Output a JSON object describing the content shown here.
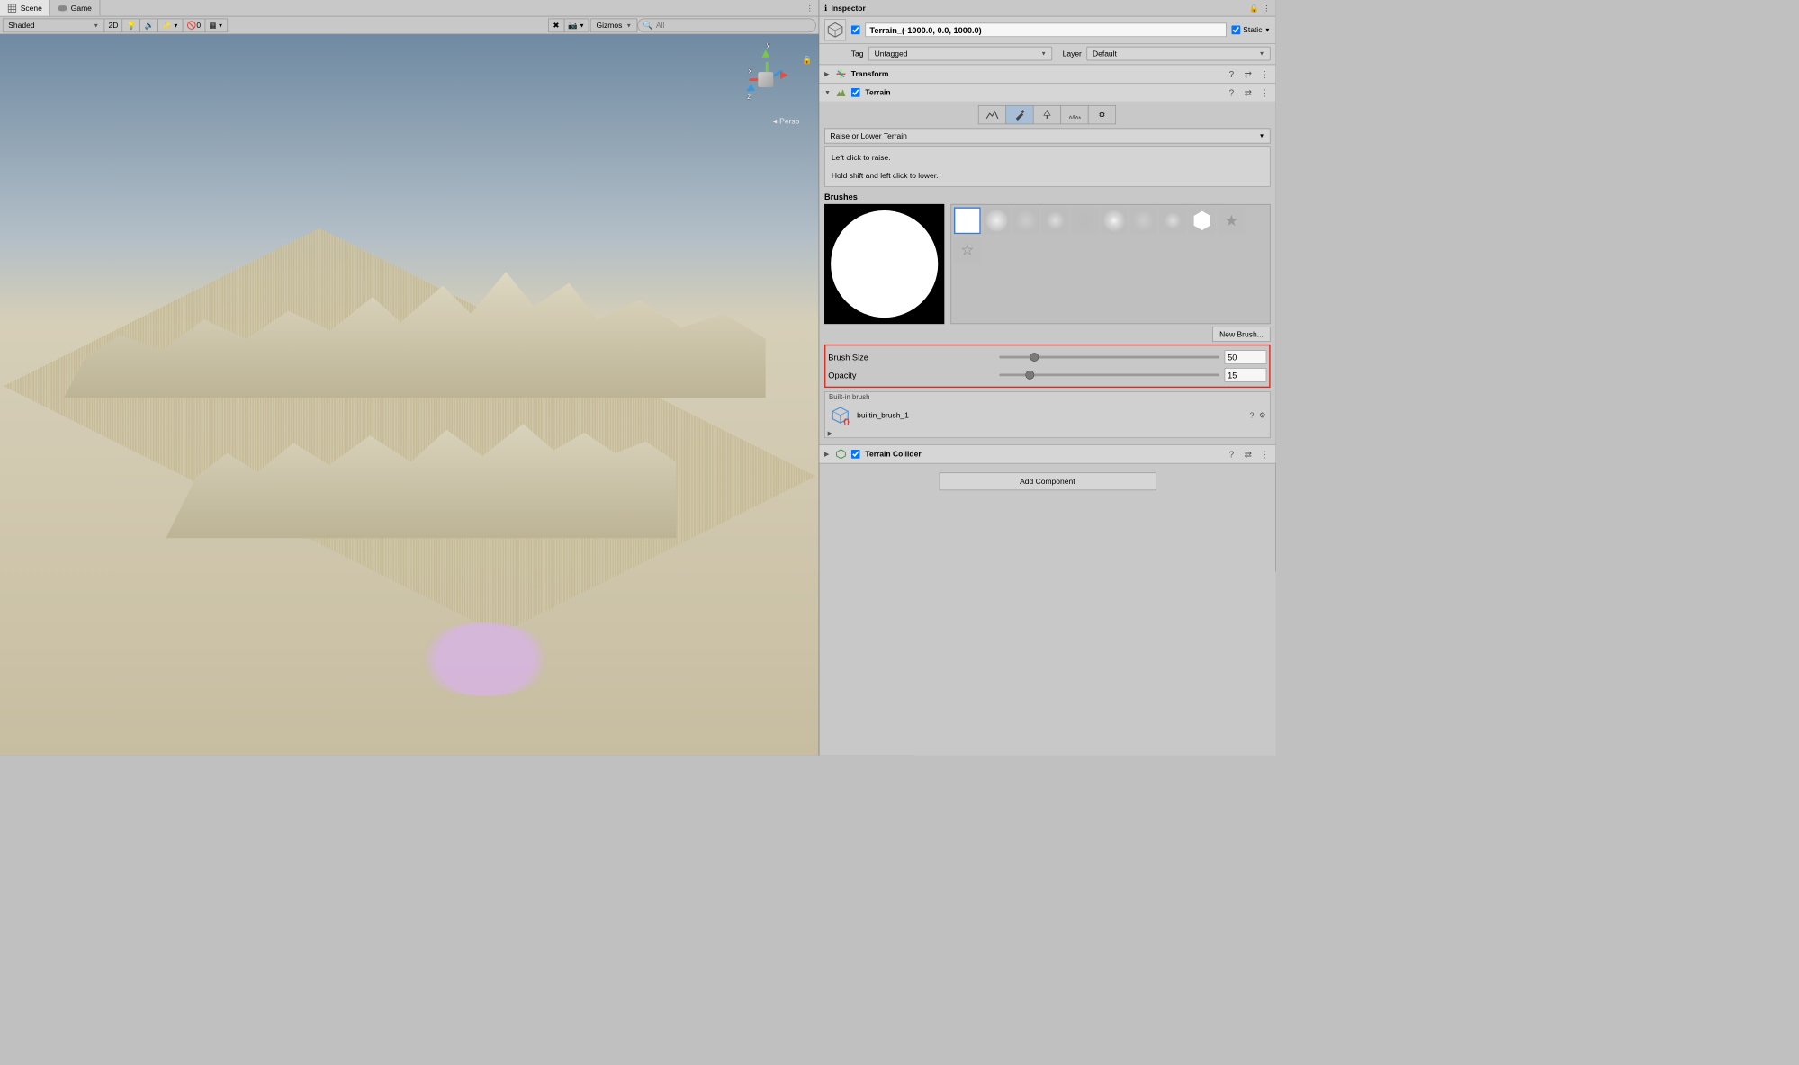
{
  "tabs": {
    "scene": "Scene",
    "game": "Game"
  },
  "scene_toolbar": {
    "shading": "Shaded",
    "twoD": "2D",
    "hidden": "0",
    "gizmos": "Gizmos",
    "search_placeholder": "All"
  },
  "gizmo": {
    "x": "x",
    "y": "y",
    "z": "z",
    "persp": "Persp"
  },
  "inspector": {
    "title": "Inspector",
    "object_name": "Terrain_(-1000.0, 0.0, 1000.0)",
    "static_label": "Static",
    "tag_label": "Tag",
    "tag_value": "Untagged",
    "layer_label": "Layer",
    "layer_value": "Default"
  },
  "components": {
    "transform": {
      "title": "Transform"
    },
    "terrain": {
      "title": "Terrain",
      "tool_dd": "Raise or Lower Terrain",
      "help_line1": "Left click to raise.",
      "help_line2": "Hold shift and left click to lower.",
      "brushes_label": "Brushes",
      "new_brush": "New Brush...",
      "brush_size_label": "Brush Size",
      "brush_size_value": "50",
      "opacity_label": "Opacity",
      "opacity_value": "15",
      "builtin_header": "Built-in brush",
      "builtin_name": "builtin_brush_1"
    },
    "collider": {
      "title": "Terrain Collider"
    }
  },
  "add_component": "Add Component"
}
